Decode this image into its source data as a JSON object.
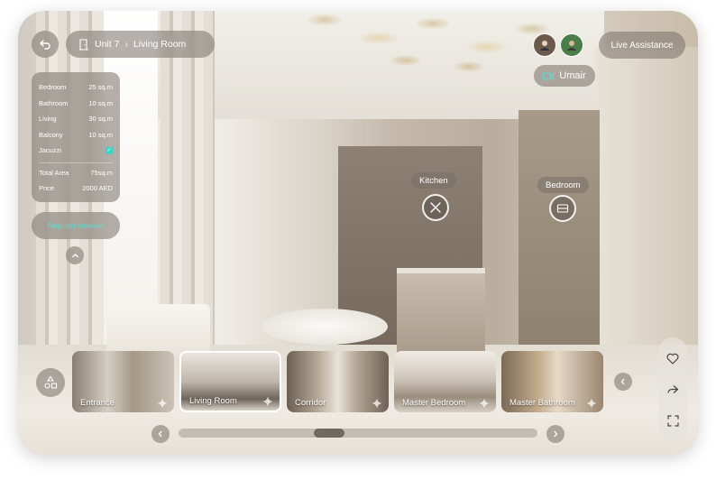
{
  "breadcrumb": {
    "unit": "Unit 7",
    "room": "Living Room"
  },
  "details": [
    {
      "label": "Bedroom",
      "value": "25 sq.m"
    },
    {
      "label": "Bathroom",
      "value": "10 sq.m"
    },
    {
      "label": "Living",
      "value": "30 sq.m"
    },
    {
      "label": "Balcony",
      "value": "10 sq.m"
    },
    {
      "label": "Jacuzzi",
      "value": ""
    }
  ],
  "jacuzzi_checked": true,
  "summary": [
    {
      "label": "Total Area",
      "value": "75sq.m"
    },
    {
      "label": "Price",
      "value": "2000 AED"
    }
  ],
  "register_label": "Register Interest",
  "live_assistance_label": "Live Assistance",
  "current_user": "Umair",
  "hotspots": {
    "kitchen": "Kitchen",
    "bedroom": "Bedroom"
  },
  "rooms": [
    {
      "label": "Entrance",
      "active": false
    },
    {
      "label": "Living Room",
      "active": true
    },
    {
      "label": "Corridor",
      "active": false
    },
    {
      "label": "Master Bedroom",
      "active": false
    },
    {
      "label": "Master Bathroom",
      "active": false
    }
  ],
  "icons": [
    "back-arrow-icon",
    "door-icon",
    "chevron-right-icon",
    "chevron-up-icon",
    "video-camera-icon",
    "utensils-icon",
    "bed-icon",
    "heart-icon",
    "share-icon",
    "fullscreen-icon",
    "shapes-icon",
    "chevron-left-icon",
    "move-icon"
  ],
  "colors": {
    "accent": "#4fe3d3",
    "glass": "#78706880"
  }
}
